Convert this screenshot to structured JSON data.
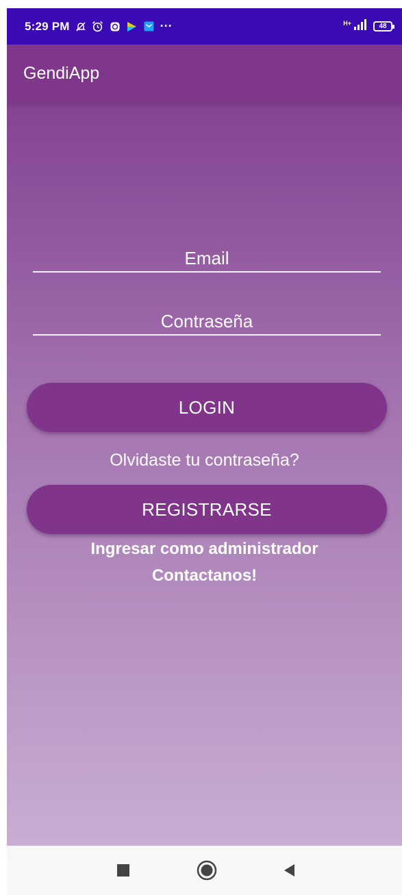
{
  "status_bar": {
    "time": "5:29 PM",
    "icons": [
      "notifications-off-icon",
      "alarm-icon",
      "app-icon",
      "play-icon",
      "message-icon",
      "more-icon"
    ],
    "more": "···",
    "network": "H+",
    "battery": "48"
  },
  "app_bar": {
    "title": "GendiApp"
  },
  "form": {
    "email_placeholder": "Email",
    "password_placeholder": "Contraseña"
  },
  "actions": {
    "login_label": "LOGIN",
    "forgot_label": "Olvidaste tu contraseña?",
    "register_label": "REGISTRARSE",
    "admin_label": "Ingresar como administrador",
    "contact_label": "Contactanos!"
  },
  "colors": {
    "status_bar": "#3a0ab5",
    "app_bar": "#7e378a",
    "button": "#80358a",
    "gradient_top": "#7e3a8c",
    "gradient_bottom": "#c8aed2"
  },
  "nav_bar": {
    "icons": [
      "recents-icon",
      "home-icon",
      "back-icon"
    ]
  }
}
